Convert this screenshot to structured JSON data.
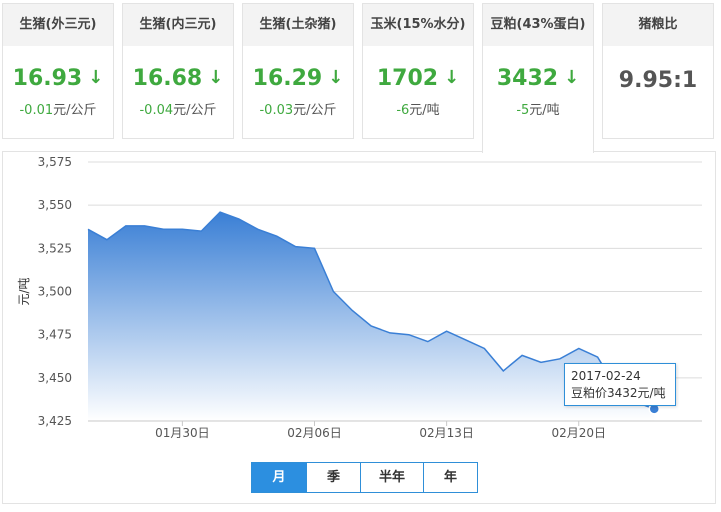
{
  "cards": [
    {
      "title": "生猪(外三元)",
      "value": "16.93",
      "arrow": "↓",
      "change": "-0.01",
      "unit": "元/公斤"
    },
    {
      "title": "生猪(内三元)",
      "value": "16.68",
      "arrow": "↓",
      "change": "-0.04",
      "unit": "元/公斤"
    },
    {
      "title": "生猪(土杂猪)",
      "value": "16.29",
      "arrow": "↓",
      "change": "-0.03",
      "unit": "元/公斤"
    },
    {
      "title": "玉米(15%水分)",
      "value": "1702",
      "arrow": "↓",
      "change": "-6",
      "unit": "元/吨"
    },
    {
      "title": "豆粕(43%蛋白)",
      "value": "3432",
      "arrow": "↓",
      "change": "-5",
      "unit": "元/吨"
    },
    {
      "title": "猪粮比",
      "value": "9.95:1"
    }
  ],
  "active_card": 4,
  "colors": {
    "line": "#3a7fd5",
    "fill_top": "#3a7fd5",
    "fill_bottom": "#ffffff",
    "down": "#3fa93f",
    "active_button": "#2c8fe0"
  },
  "periods": [
    "月",
    "季",
    "半年",
    "年"
  ],
  "active_period": 0,
  "tooltip": {
    "date": "2017-02-24",
    "text": "豆粕价3432元/吨"
  },
  "chart_data": {
    "type": "area",
    "ylabel": "元/吨",
    "ylim": [
      3425,
      3575
    ],
    "yticks": [
      "3,575",
      "3,550",
      "3,525",
      "3,500",
      "3,475",
      "3,450",
      "3,425"
    ],
    "xticks": [
      {
        "label": "01月30日",
        "x": "2017-01-30"
      },
      {
        "label": "02月06日",
        "x": "2017-02-06"
      },
      {
        "label": "02月13日",
        "x": "2017-02-13"
      },
      {
        "label": "02月20日",
        "x": "2017-02-20"
      }
    ],
    "series": [
      {
        "x": [
          "2017-01-25",
          "2017-01-26",
          "2017-01-27",
          "2017-01-28",
          "2017-01-29",
          "2017-01-30",
          "2017-01-31",
          "2017-02-01",
          "2017-02-02",
          "2017-02-03",
          "2017-02-04",
          "2017-02-05",
          "2017-02-06",
          "2017-02-07",
          "2017-02-08",
          "2017-02-09",
          "2017-02-10",
          "2017-02-11",
          "2017-02-12",
          "2017-02-13",
          "2017-02-14",
          "2017-02-15",
          "2017-02-16",
          "2017-02-17",
          "2017-02-18",
          "2017-02-19",
          "2017-02-20",
          "2017-02-21",
          "2017-02-22",
          "2017-02-23",
          "2017-02-24"
        ],
        "values": [
          3536,
          3530,
          3538,
          3538,
          3536,
          3536,
          3535,
          3546,
          3542,
          3536,
          3532,
          3526,
          3525,
          3500,
          3489,
          3480,
          3476,
          3475,
          3471,
          3477,
          3472,
          3467,
          3454,
          3463,
          3459,
          3461,
          3467,
          3462,
          3444,
          3436,
          3432
        ]
      }
    ],
    "highlight": {
      "x": "2017-02-24",
      "y": 3432
    },
    "grid": true,
    "legend": "none"
  }
}
